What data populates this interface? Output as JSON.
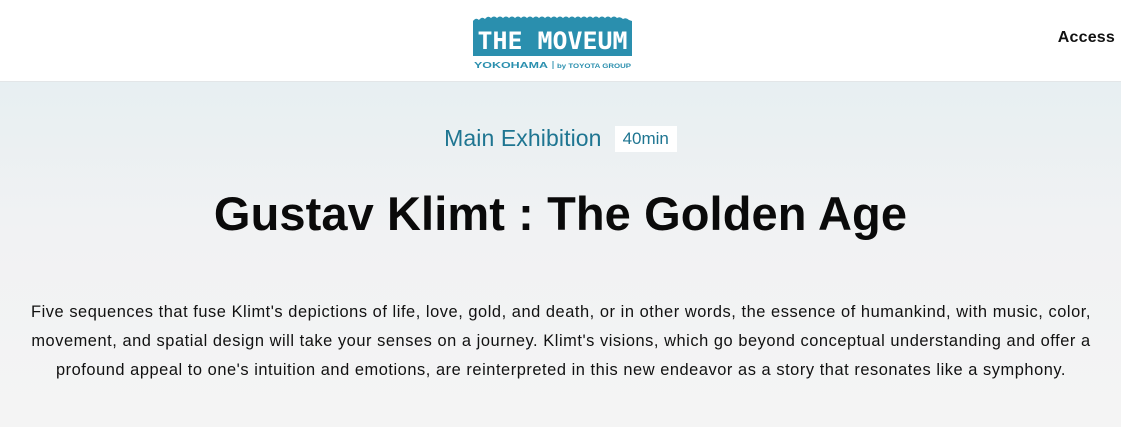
{
  "header": {
    "logo": {
      "title": "THE MOVEUM",
      "location": "YOKOHAMA",
      "byline": "by TOYOTA GROUP",
      "brand_color": "#2a8fae"
    },
    "nav": {
      "access_label": "Access"
    }
  },
  "main": {
    "section_label": "Main Exhibition",
    "duration": "40min",
    "title": "Gustav Klimt : The Golden Age",
    "description": "Five sequences that fuse Klimt's depictions of life, love, gold, and death, or in other words, the essence of humankind, with music, color, movement, and spatial design will take your senses on a journey.  Klimt's visions, which go beyond conceptual understanding and offer a profound appeal to one's intuition and emotions, are reinterpreted in this new endeavor as a story that resonates like a symphony.",
    "accent_color": "#1e7591"
  }
}
